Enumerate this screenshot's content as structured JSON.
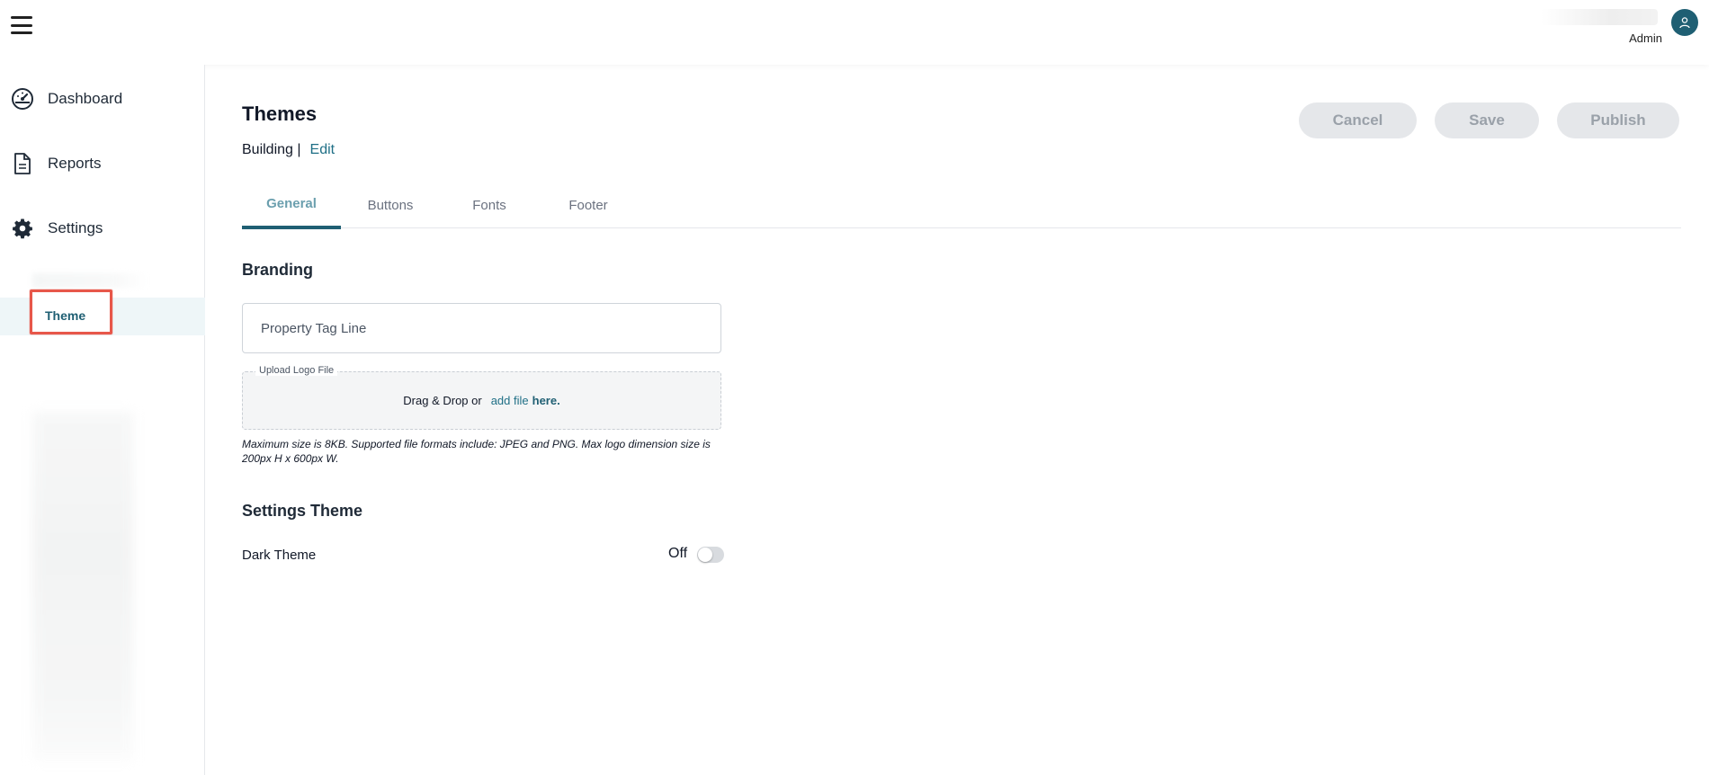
{
  "header": {
    "user_name": "Admin"
  },
  "sidebar": {
    "items": [
      {
        "label": "Dashboard",
        "icon": "gauge-icon"
      },
      {
        "label": "Reports",
        "icon": "document-icon"
      },
      {
        "label": "Settings",
        "icon": "gear-icon"
      }
    ],
    "sub_items": [
      {
        "label": "Theme",
        "selected": true
      }
    ]
  },
  "page": {
    "title": "Themes",
    "breadcrumb_text": "Building |",
    "breadcrumb_edit": "Edit"
  },
  "actions": {
    "cancel": "Cancel",
    "save": "Save",
    "publish": "Publish"
  },
  "tabs": [
    {
      "label": "General",
      "active": true
    },
    {
      "label": "Buttons",
      "active": false
    },
    {
      "label": "Fonts",
      "active": false
    },
    {
      "label": "Footer",
      "active": false
    }
  ],
  "branding": {
    "title": "Branding",
    "tagline_placeholder": "Property Tag Line",
    "upload_label": "Upload Logo File",
    "upload_prompt": "Drag & Drop or",
    "upload_link": "add file",
    "upload_suffix": "here.",
    "hint": "Maximum size is 8KB. Supported file formats include: JPEG and PNG. Max logo dimension size is 200px H x 600px W."
  },
  "settings_theme": {
    "title": "Settings Theme",
    "dark_theme_label": "Dark Theme",
    "dark_theme_state": "Off",
    "dark_theme_on": false
  },
  "colors": {
    "accent": "#1f5f73",
    "highlight": "#e7574a"
  }
}
